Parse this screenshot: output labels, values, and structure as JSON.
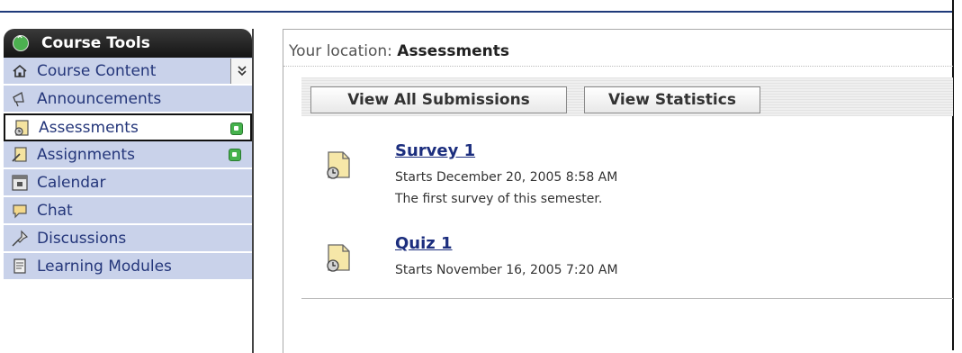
{
  "sidebar": {
    "header": "Course Tools",
    "items": [
      {
        "label": "Course Content",
        "icon": "home-icon"
      },
      {
        "label": "Announcements",
        "icon": "megaphone-icon"
      },
      {
        "label": "Assessments",
        "icon": "assessment-icon",
        "selected": true
      },
      {
        "label": "Assignments",
        "icon": "assignment-icon"
      },
      {
        "label": "Calendar",
        "icon": "calendar-icon"
      },
      {
        "label": "Chat",
        "icon": "chat-icon"
      },
      {
        "label": "Discussions",
        "icon": "pushpin-icon"
      },
      {
        "label": "Learning Modules",
        "icon": "modules-icon"
      }
    ]
  },
  "main": {
    "location_label": "Your location:",
    "location_value": "Assessments",
    "buttons": {
      "view_all_submissions": "View All Submissions",
      "view_statistics": "View Statistics"
    },
    "assessments": [
      {
        "title": "Survey 1",
        "starts": "Starts December 20, 2005 8:58 AM",
        "description": "The first survey of this semester."
      },
      {
        "title": "Quiz 1",
        "starts": "Starts November 16, 2005 7:20 AM"
      }
    ]
  },
  "colors": {
    "sidebar_item_bg": "#c9d2ea",
    "link": "#1c2e7e",
    "badge_green": "#46b24d"
  }
}
